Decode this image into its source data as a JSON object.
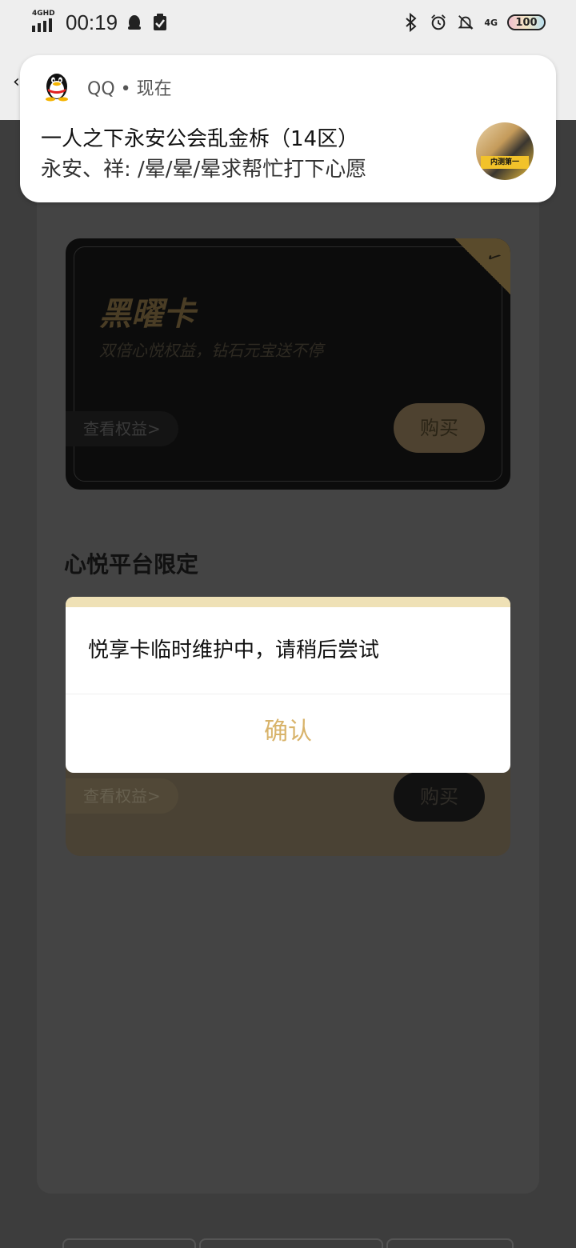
{
  "status_bar": {
    "network": "4GHD",
    "time": "00:19",
    "network_right": "4G",
    "battery": "100"
  },
  "page": {
    "card1": {
      "name": "黑曜卡",
      "desc": "双倍心悦权益，钻石元宝送不停",
      "view_benefits": "查看权益>",
      "buy": "购买"
    },
    "section2_title": "心悦平台限定",
    "card2": {
      "view_benefits": "查看权益>",
      "buy": "购买"
    }
  },
  "notification": {
    "app": "QQ",
    "time_label": "现在",
    "title": "一人之下永安公会乱金柝（14区）",
    "body": "永安、祥: /晕/晕/晕求帮忙打下心愿",
    "thumb_text": "内测第一"
  },
  "dialog": {
    "message": "悦享卡临时维护中，请稍后尝试",
    "confirm": "确认"
  },
  "colors": {
    "gold_accent": "#d8b36a",
    "dialog_top": "#efe1b6",
    "overlay": "#3d3d3d"
  }
}
